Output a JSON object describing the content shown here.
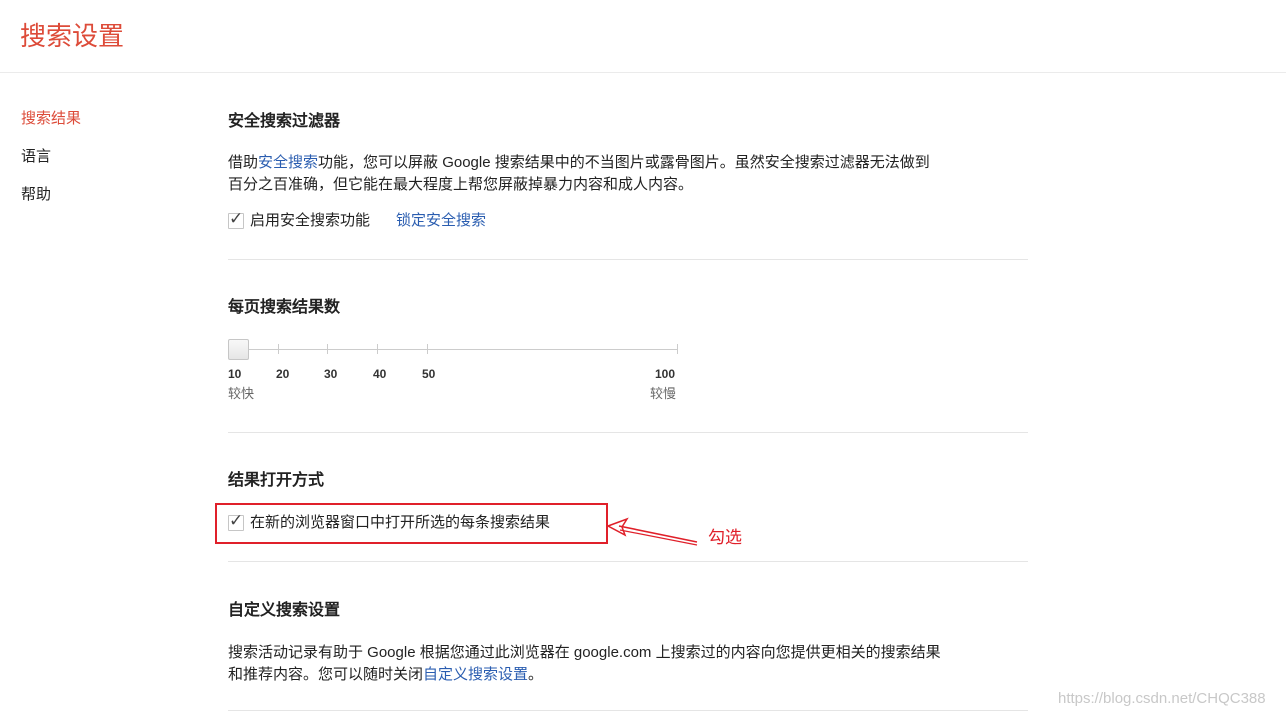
{
  "header": {
    "title": "搜索设置"
  },
  "sidebar": {
    "items": [
      {
        "label": "搜索结果",
        "active": true
      },
      {
        "label": "语言",
        "active": false
      },
      {
        "label": "帮助",
        "active": false
      }
    ]
  },
  "safe_search": {
    "title": "安全搜索过滤器",
    "desc_prefix": "借助",
    "desc_link": "安全搜索",
    "desc_suffix_line1": "功能，您可以屏蔽 Google 搜索结果中的不当图片或露骨图片。虽然安全搜索过滤器无法做到",
    "desc_line2": "百分之百准确，但它能在最大程度上帮您屏蔽掉暴力内容和成人内容。",
    "checkbox_label": "启用安全搜索功能",
    "checked": true,
    "lock_link": "锁定安全搜索"
  },
  "results_per_page": {
    "title": "每页搜索结果数",
    "ticks": [
      "10",
      "20",
      "30",
      "40",
      "50",
      "100"
    ],
    "value": 10,
    "fast_label": "较快",
    "slow_label": "较慢"
  },
  "open_mode": {
    "title": "结果打开方式",
    "checkbox_label": "在新的浏览器窗口中打开所选的每条搜索结果",
    "checked": true
  },
  "custom_search": {
    "title": "自定义搜索设置",
    "desc_line1": "搜索活动记录有助于 Google 根据您通过此浏览器在 google.com 上搜索过的内容向您提供更相关的搜索结果",
    "desc_prefix_line2": "和推荐内容。您可以随时关闭",
    "desc_link": "自定义搜索设置",
    "desc_suffix": "。"
  },
  "annotation": {
    "text": "勾选",
    "color": "#e0202a"
  },
  "watermark": {
    "text": "https://blog.csdn.net/CHQC388"
  },
  "colors": {
    "accent": "#dd4b39",
    "link": "#2a5db0"
  },
  "icons": {
    "check": "check-icon",
    "arrow": "arrow-left-icon"
  }
}
